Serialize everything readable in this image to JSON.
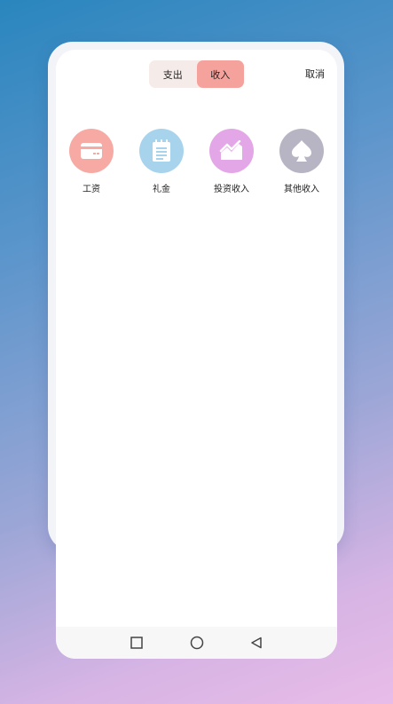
{
  "header": {
    "tabs": [
      {
        "label": "支出",
        "active": false
      },
      {
        "label": "收入",
        "active": true
      }
    ],
    "cancel_label": "取消"
  },
  "categories": [
    {
      "label": "工资",
      "icon": "card-icon",
      "color": "#f7aaa4"
    },
    {
      "label": "礼金",
      "icon": "notepad-icon",
      "color": "#a8d3ec"
    },
    {
      "label": "投资收入",
      "icon": "trend-chart-icon",
      "color": "#e3a6e6"
    },
    {
      "label": "其他收入",
      "icon": "spade-icon",
      "color": "#b7b5c3"
    }
  ],
  "navbar": {
    "buttons": [
      "recent-apps",
      "home",
      "back"
    ]
  },
  "colors": {
    "accent": "#f6a29c",
    "toggle_bg": "#f5ecea"
  }
}
